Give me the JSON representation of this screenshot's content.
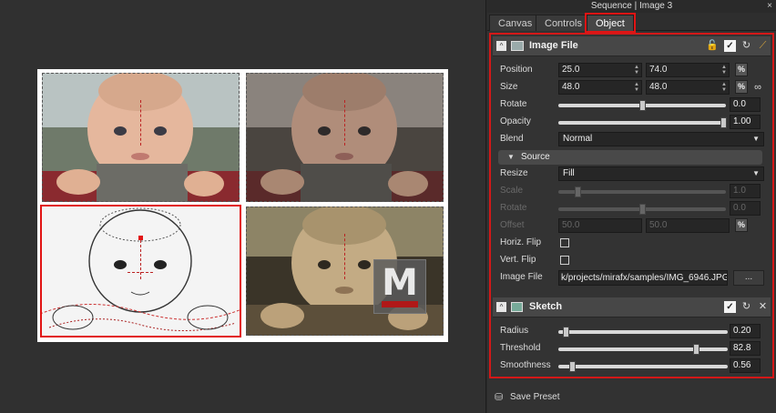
{
  "window": {
    "title": "Sequence | Image 3",
    "close_glyph": "×"
  },
  "tabs": [
    {
      "label": "Canvas",
      "active": false
    },
    {
      "label": "Controls",
      "active": false
    },
    {
      "label": "Object",
      "active": true
    }
  ],
  "image_file_section": {
    "title": "Image File",
    "icons": [
      "lock-icon",
      "checkbox-checked-icon",
      "reset-icon",
      "wand-icon"
    ],
    "position": {
      "label": "Position",
      "x": "25.0",
      "y": "74.0",
      "unit": "%"
    },
    "size": {
      "label": "Size",
      "w": "48.0",
      "h": "48.0",
      "unit": "%"
    },
    "rotate": {
      "label": "Rotate",
      "value": "0.0",
      "level": 0.5
    },
    "opacity": {
      "label": "Opacity",
      "value": "1.00",
      "level": 1.0
    },
    "blend": {
      "label": "Blend",
      "value": "Normal"
    },
    "source": {
      "label": "Source"
    },
    "resize": {
      "label": "Resize",
      "value": "Fill"
    },
    "scale": {
      "label": "Scale",
      "value": "1.0",
      "level": 0.1
    },
    "rotate_disabled": {
      "label": "Rotate",
      "value": "0.0",
      "level": 0.5
    },
    "offset": {
      "label": "Offset",
      "x": "50.0",
      "y": "50.0",
      "unit": "%"
    },
    "horiz_flip": {
      "label": "Horiz. Flip",
      "checked": false
    },
    "vert_flip": {
      "label": "Vert. Flip",
      "checked": false
    },
    "image_file": {
      "label": "Image File",
      "value": "k/projects/mirafx/samples/IMG_6946.JPG",
      "browse": "..."
    }
  },
  "sketch_section": {
    "title": "Sketch",
    "icons": [
      "checkbox-checked-icon",
      "reset-icon",
      "remove-icon"
    ],
    "radius": {
      "label": "Radius",
      "value": "0.20",
      "level": 0.04
    },
    "threshold": {
      "label": "Threshold",
      "value": "82.8",
      "level": 0.828
    },
    "smoothness": {
      "label": "Smoothness",
      "value": "0.56",
      "level": 0.08
    }
  },
  "footer": {
    "save_preset": "Save Preset"
  },
  "watermark": {
    "letter": "M"
  },
  "colors": {
    "accent_red": "#e11414",
    "panel_bg": "#323232",
    "header_bg": "#474747"
  }
}
